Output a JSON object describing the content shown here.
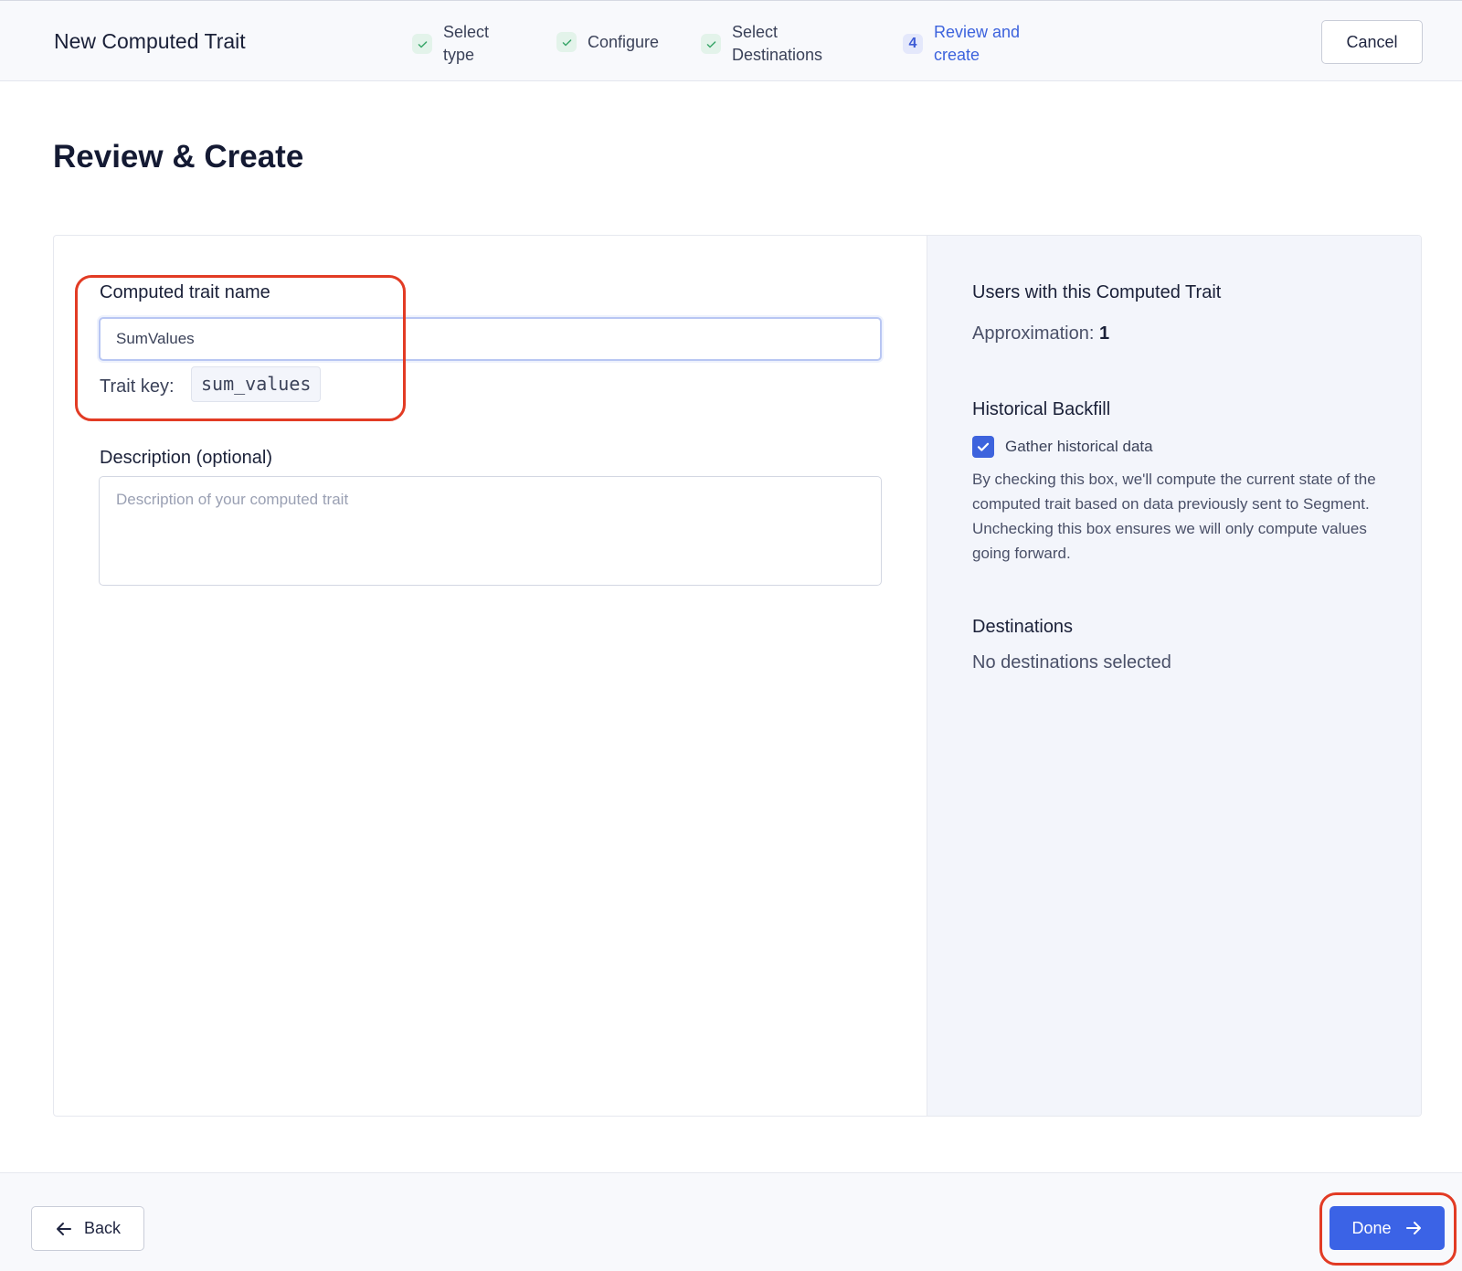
{
  "header": {
    "title": "New Computed Trait",
    "cancel_label": "Cancel",
    "steps": [
      {
        "line1": "Select",
        "line2": "type",
        "state": "complete"
      },
      {
        "line1": "Configure",
        "line2": "",
        "state": "complete"
      },
      {
        "line1": "Select",
        "line2": "Destinations",
        "state": "complete"
      },
      {
        "number": "4",
        "line1": "Review and",
        "line2": "create",
        "state": "current"
      }
    ]
  },
  "page": {
    "title": "Review & Create"
  },
  "form": {
    "name_label": "Computed trait name",
    "name_value": "SumValues",
    "trait_key_label": "Trait key:",
    "trait_key_value": "sum_values",
    "description_label": "Description (optional)",
    "description_placeholder": "Description of your computed trait",
    "description_value": ""
  },
  "summary": {
    "users_heading": "Users with this Computed Trait",
    "approximation_label": "Approximation:",
    "approximation_value": "1",
    "backfill_heading": "Historical Backfill",
    "backfill_checkbox_label": "Gather historical data",
    "backfill_checked": true,
    "backfill_help": "By checking this box, we'll compute the current state of the computed trait based on data previously sent to Segment. Unchecking this box ensures we will only compute values going forward.",
    "destinations_heading": "Destinations",
    "destinations_value": "No destinations selected"
  },
  "footer": {
    "back_label": "Back",
    "done_label": "Done"
  },
  "colors": {
    "accent": "#3b63e6",
    "step_complete": "#3aa66a",
    "highlight": "#e23b24"
  }
}
